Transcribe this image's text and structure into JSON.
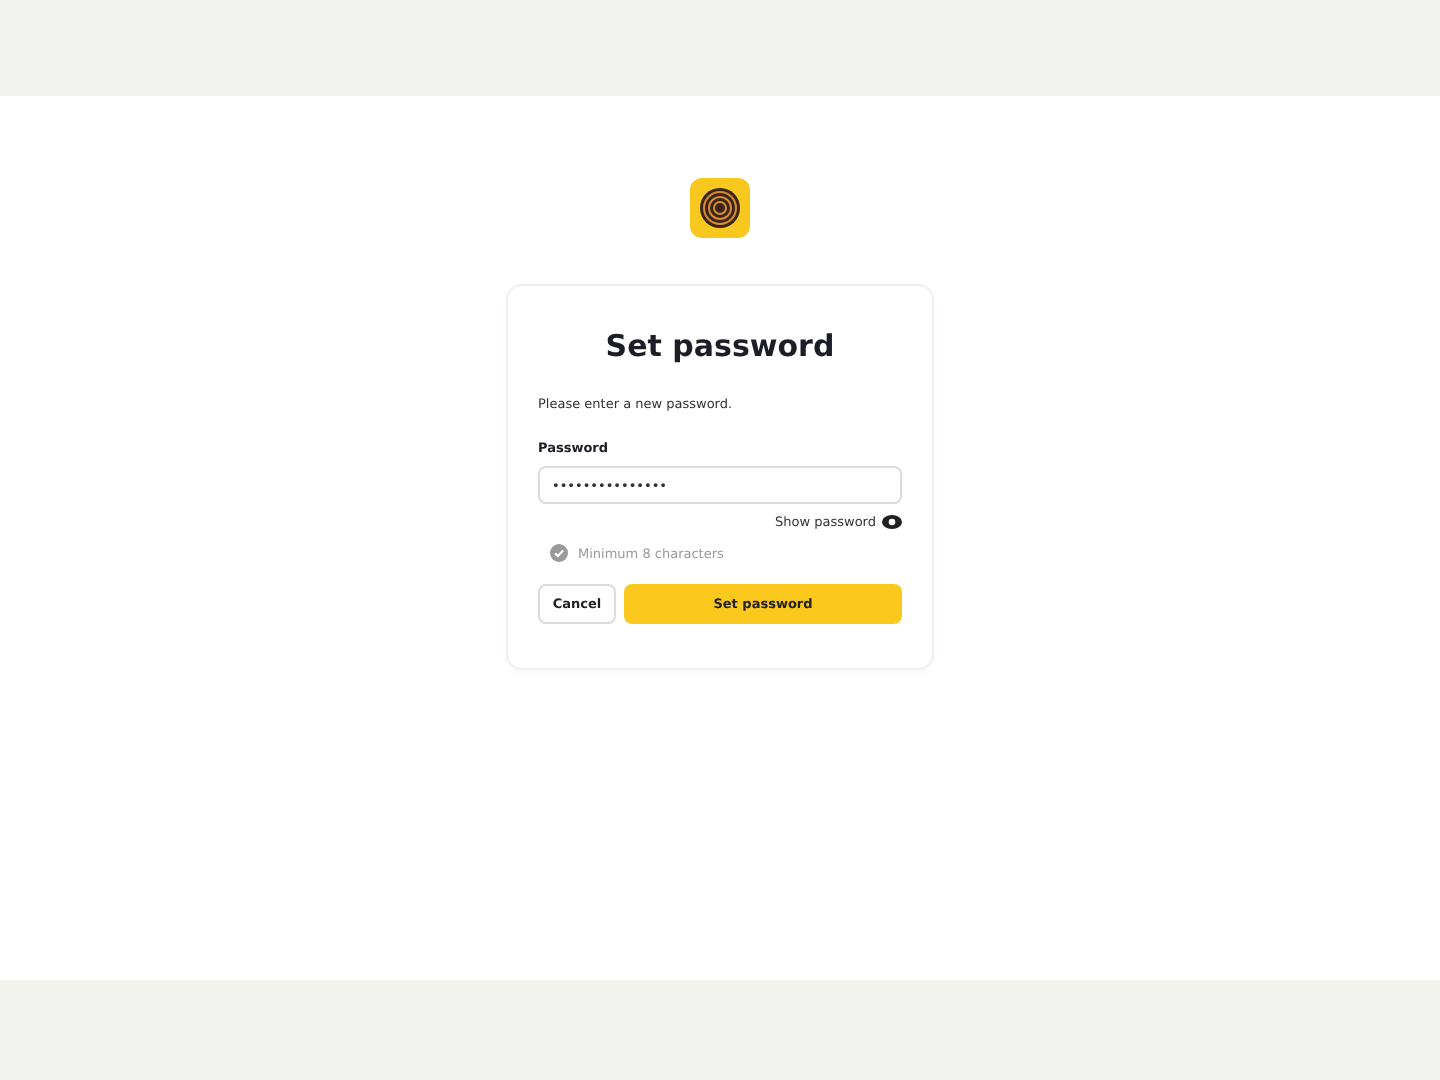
{
  "title": "Set password",
  "instruction": "Please enter a new password.",
  "password_field": {
    "label": "Password",
    "value": "•••••••••••••••"
  },
  "show_password": {
    "label": "Show password",
    "checked": false
  },
  "requirements": [
    {
      "label": "Minimum 8 characters",
      "met": false
    }
  ],
  "buttons": [
    {
      "label": "Cancel",
      "kind": "secondary"
    },
    {
      "label": "Set password",
      "kind": "primary"
    }
  ]
}
